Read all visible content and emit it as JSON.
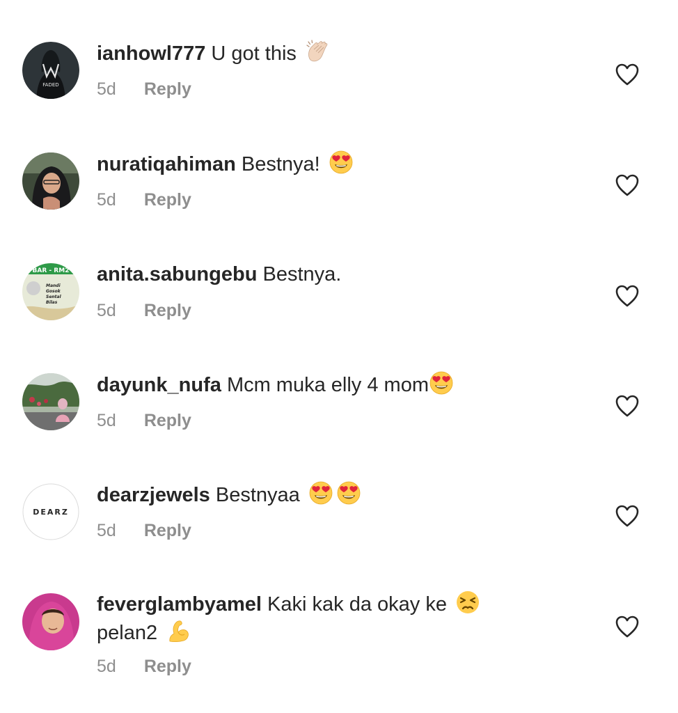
{
  "comments": [
    {
      "username": "ianhowl777",
      "text": "U got this",
      "emoji_names": [
        "clapping-hands-icon"
      ],
      "time": "5d",
      "reply_label": "Reply",
      "avatar_label": "FADED"
    },
    {
      "username": "nuratiqahiman",
      "text": "Bestnya!",
      "emoji_names": [
        "heart-eyes-icon"
      ],
      "time": "5d",
      "reply_label": "Reply"
    },
    {
      "username": "anita.sabungebu",
      "text": "Bestnya.",
      "emoji_names": [],
      "time": "5d",
      "reply_label": "Reply",
      "avatar_label": "BAR - RM2",
      "avatar_list": [
        "Mandi",
        "Gosok",
        "Sental",
        "Bilas"
      ]
    },
    {
      "username": "dayunk_nufa",
      "text": "Mcm muka elly 4 mom",
      "emoji_names": [
        "heart-eyes-icon"
      ],
      "time": "5d",
      "reply_label": "Reply"
    },
    {
      "username": "dearzjewels",
      "text": "Bestnyaa",
      "emoji_names": [
        "heart-eyes-icon",
        "heart-eyes-icon"
      ],
      "time": "5d",
      "reply_label": "Reply",
      "avatar_label": "DEARZ"
    },
    {
      "username": "feverglambyamel",
      "text": "Kaki kak da okay ke",
      "emoji_names": [
        "persevering-face-icon"
      ],
      "text2": "pelan2",
      "emoji2_names": [
        "flexed-biceps-icon"
      ],
      "time": "5d",
      "reply_label": "Reply"
    }
  ],
  "colors": {
    "text": "#262626",
    "meta": "#8e8e8e",
    "heart_outline": "#262626"
  }
}
